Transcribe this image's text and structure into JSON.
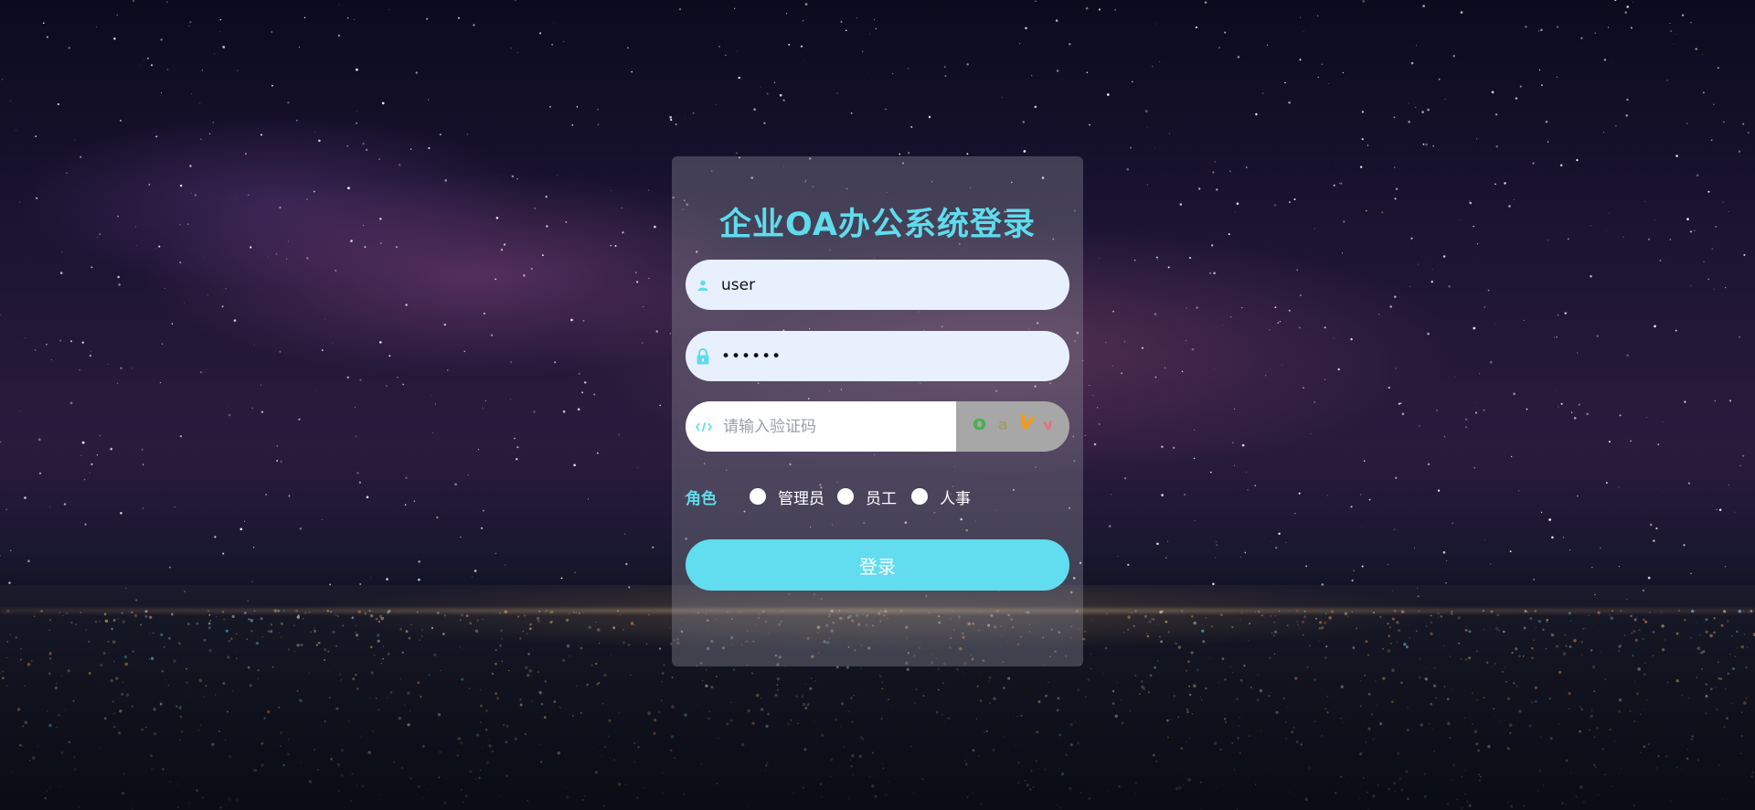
{
  "page": {
    "title": "企业OA办公系统登录"
  },
  "colors": {
    "accent": "#5fdcec",
    "button": "#62dcef",
    "field_bg": "#e8f0fe",
    "captcha_bg": "#a7a7a7"
  },
  "login_form": {
    "username": {
      "icon": "user-icon",
      "value": "user"
    },
    "password": {
      "icon": "lock-icon",
      "masked_value": "••••••"
    },
    "captcha": {
      "icon": "code-icon",
      "placeholder": "请输入验证码",
      "image_text": [
        "o",
        "a",
        "V",
        "v"
      ]
    },
    "role": {
      "label": "角色",
      "options": [
        "管理员",
        "员工",
        "人事"
      ]
    },
    "submit_label": "登录"
  }
}
